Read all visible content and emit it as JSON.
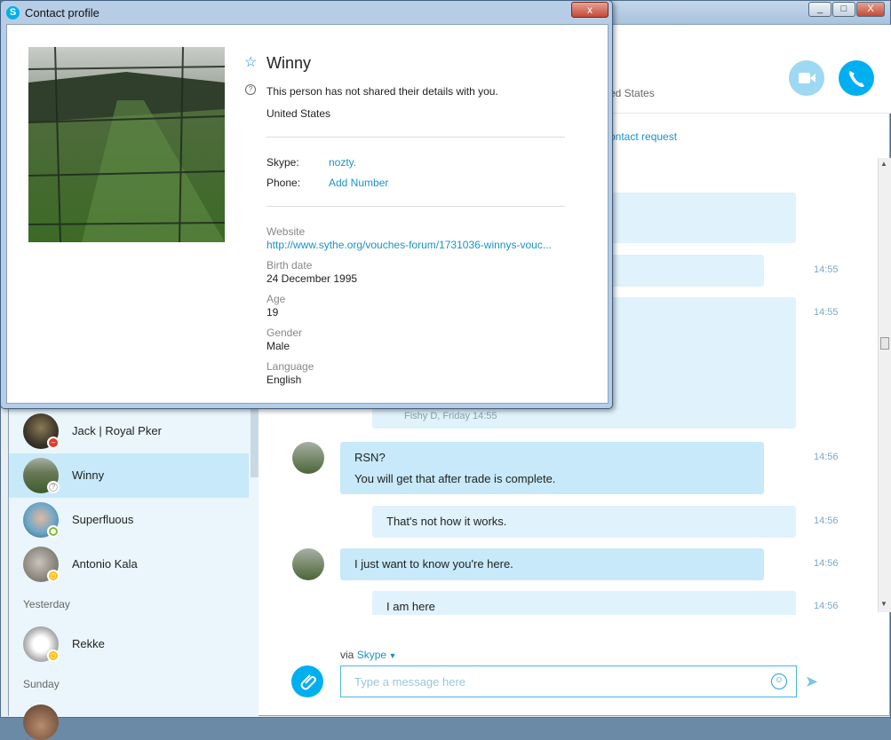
{
  "dialog": {
    "title": "Contact profile",
    "close_label": "x",
    "name": "Winny",
    "privacy_note": "This person has not shared their details with you.",
    "location": "United States",
    "skype_label": "Skype:",
    "skype_value": "nozty.",
    "phone_label": "Phone:",
    "phone_value": "Add Number",
    "website_label": "Website",
    "website_value": "http://www.sythe.org/vouches-forum/1731036-winnys-vouc...",
    "birth_label": "Birth date",
    "birth_value": "24 December 1995",
    "age_label": "Age",
    "age_value": "19",
    "gender_label": "Gender",
    "gender_value": "Male",
    "language_label": "Language",
    "language_value": "English"
  },
  "header": {
    "location_fragment": "ed States",
    "contact_request_fragment": "ontact request"
  },
  "sidebar": {
    "contacts": [
      {
        "name": "Jack | Royal Pker",
        "status": "busy"
      },
      {
        "name": "Winny",
        "status": "unknown"
      },
      {
        "name": "Superfluous",
        "status": "online"
      },
      {
        "name": "Antonio Kala",
        "status": "away"
      },
      {
        "name": "Rekke",
        "status": "away"
      }
    ],
    "section_yesterday": "Yesterday",
    "section_sunday": "Sunday"
  },
  "messages": {
    "quote_meta": "Fishy D, Friday 14:55",
    "m1_line1": "RSN?",
    "m1_line2": "You will get that after trade is complete.",
    "m2": "That's not how it works.",
    "m3": "I just want to know you're here.",
    "m4": "I am here",
    "times": [
      "14:55",
      "14:55",
      "14:56",
      "14:56",
      "14:56",
      "14:56"
    ]
  },
  "composer": {
    "via_prefix": "via",
    "via_service": "Skype",
    "placeholder": "Type a message here"
  },
  "window": {
    "minimize": "_",
    "maximize": "□",
    "close": "X"
  },
  "colors": {
    "accent": "#00aff0",
    "incoming_bubble": "#c7e9f9",
    "outgoing_bubble": "#e0f2fb",
    "link": "#1a92c9"
  }
}
